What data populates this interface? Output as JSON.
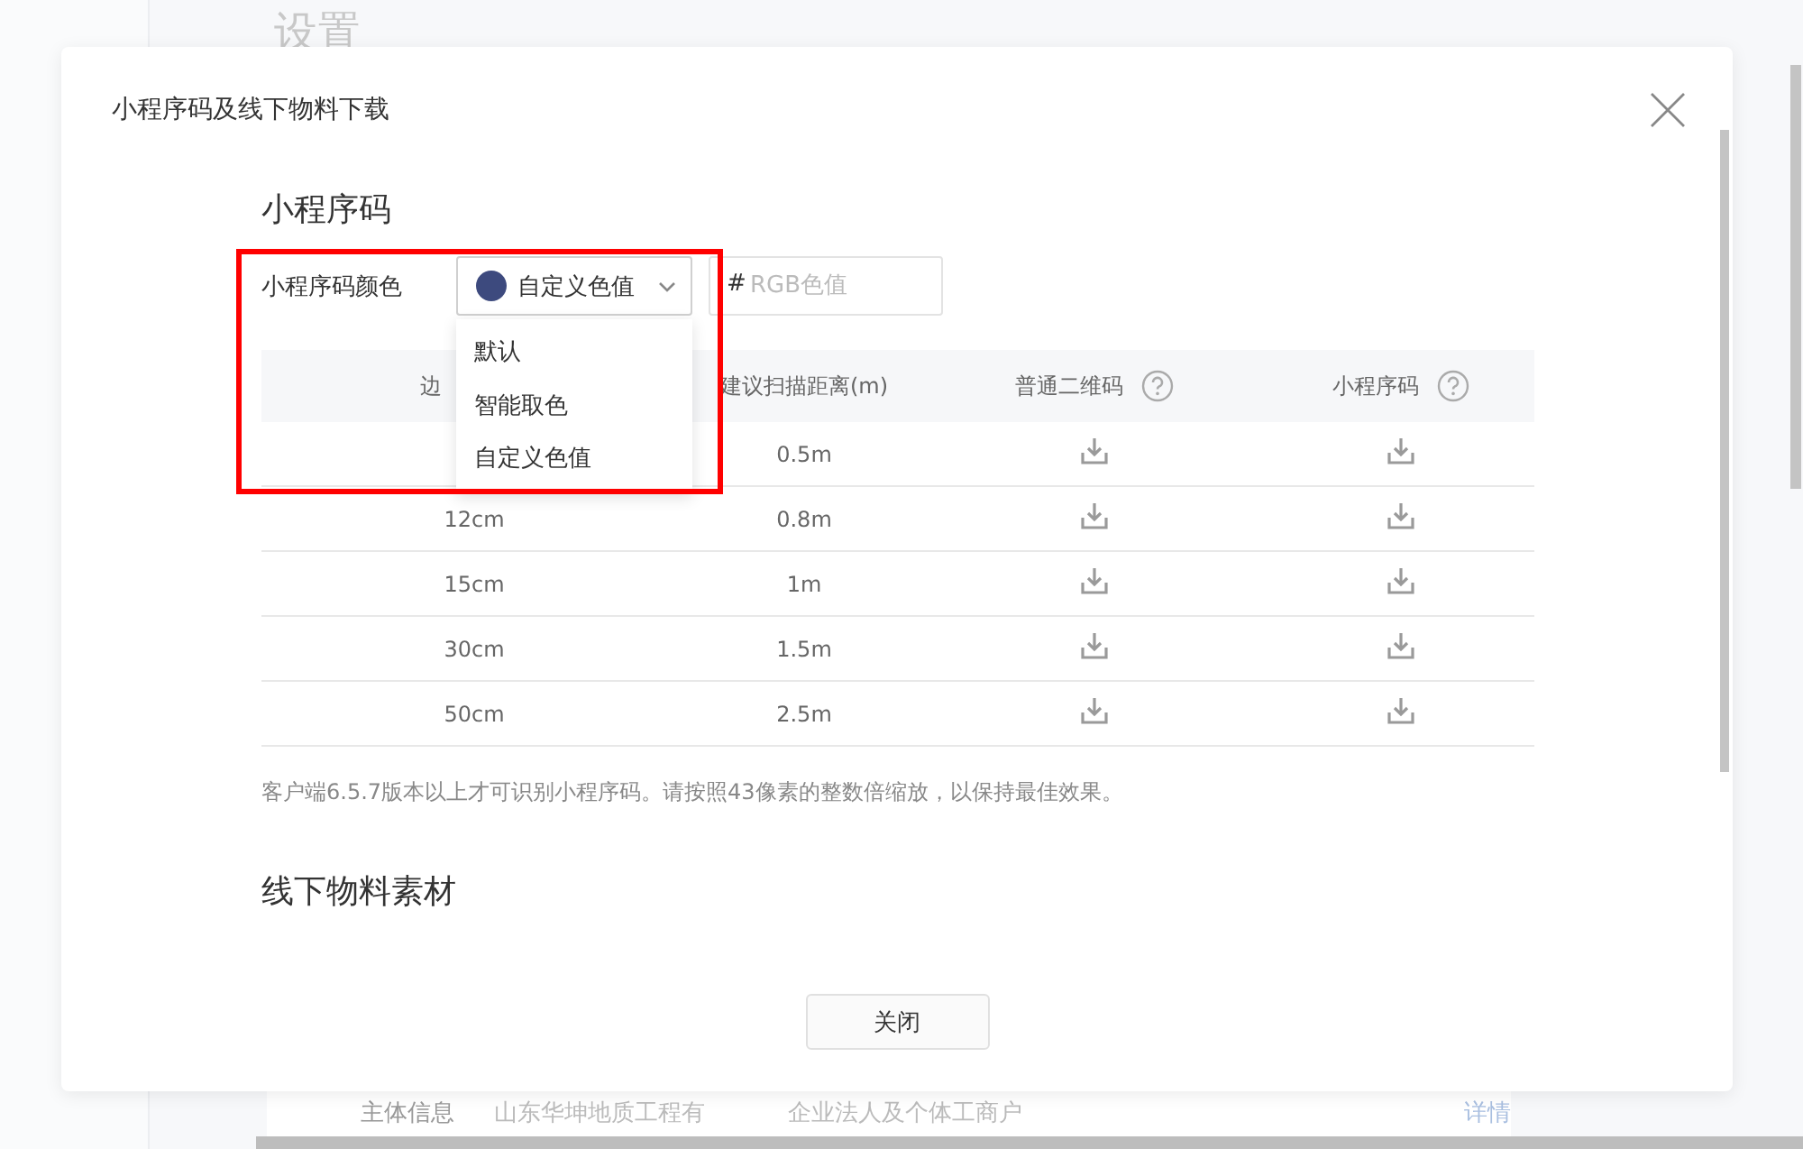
{
  "page": {
    "title": "设置",
    "info_row": {
      "label": "主体信息",
      "company": "山东华坤地质工程有",
      "type": "企业法人及个体工商户",
      "link": "详情"
    }
  },
  "dialog": {
    "title": "小程序码及线下物料下载",
    "section_title": "小程序码",
    "color_field": {
      "label": "小程序码颜色",
      "value": "自定义色值",
      "color": "#3d4a7e",
      "expanded": true,
      "options": [
        "默认",
        "智能取色",
        "自定义色值"
      ],
      "hash": "#",
      "placeholder": "RGB色值"
    },
    "table": {
      "columns": [
        {
          "label": "边",
          "help": false
        },
        {
          "label": "建议扫描距离(m)",
          "help": false
        },
        {
          "label": "普通二维码",
          "help": true
        },
        {
          "label": "小程序码",
          "help": true
        }
      ],
      "rows": [
        {
          "distance": "0.5m"
        },
        {
          "size": "12cm",
          "distance": "0.8m"
        },
        {
          "size": "15cm",
          "distance": "1m"
        },
        {
          "size": "30cm",
          "distance": "1.5m"
        },
        {
          "size": "50cm",
          "distance": "2.5m"
        }
      ]
    },
    "note": "客户端6.5.7版本以上才可识别小程序码。请按照43像素的整数倍缩放，以保持最佳效果。",
    "section2_title": "线下物料素材",
    "close_button": "关闭"
  }
}
